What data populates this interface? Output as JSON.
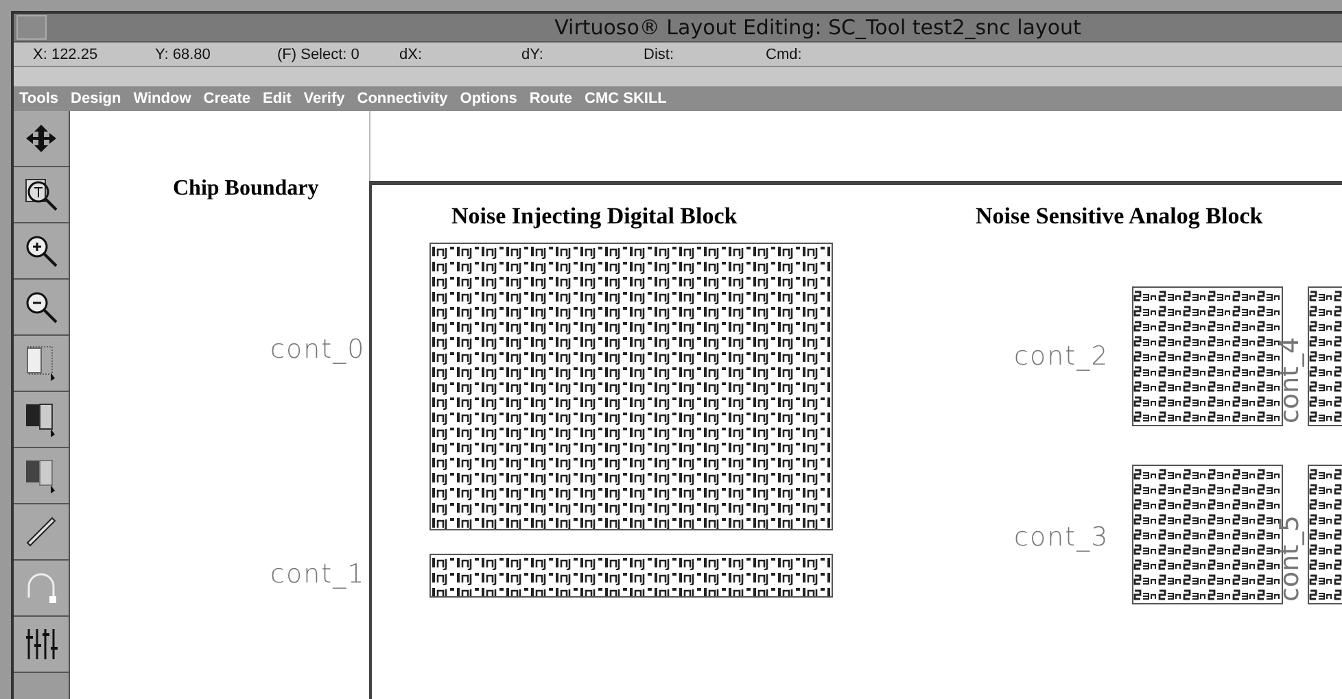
{
  "window": {
    "title": "Virtuoso® Layout Editing: SC_Tool test2_snc layout"
  },
  "status_bar": [
    "X: 122.25",
    "Y: 68.80",
    "(F) Select: 0",
    "dX:",
    "dY:",
    "Dist:",
    "Cmd:"
  ],
  "menu": [
    "Tools",
    "Design",
    "Window",
    "Create",
    "Edit",
    "Verify",
    "Connectivity",
    "Options",
    "Route",
    "CMC SKILL"
  ],
  "toolbar": [
    {
      "kind": "move"
    },
    {
      "kind": "zoom-fit"
    },
    {
      "kind": "zoom-in"
    },
    {
      "kind": "zoom-out"
    },
    {
      "kind": "select-area"
    },
    {
      "kind": "select-full"
    },
    {
      "kind": "select-partial"
    },
    {
      "kind": "ruler"
    },
    {
      "kind": "arc"
    },
    {
      "kind": "sliders"
    }
  ],
  "canvas": {
    "boundary_label": "Chip Boundary",
    "digital": {
      "title": "Noise Injecting Digital Block",
      "labels": [
        "cont_0",
        "cont_1"
      ]
    },
    "analog": {
      "title": "Noise Sensitive Analog Block",
      "labels": [
        "cont_2",
        "cont_3"
      ],
      "vertical_labels": [
        "cont_4",
        "cont_5"
      ]
    }
  }
}
